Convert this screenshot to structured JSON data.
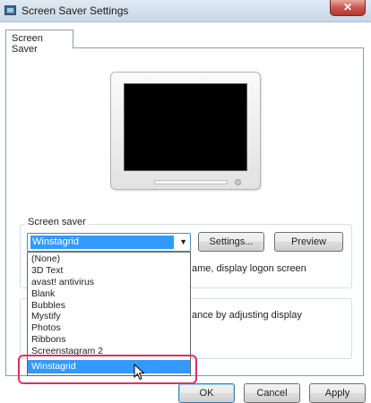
{
  "window": {
    "title": "Screen Saver Settings",
    "close_glyph": "✕"
  },
  "tabs": [
    {
      "label": "Screen Saver"
    }
  ],
  "screen_saver_group": {
    "legend": "Screen saver",
    "selected": "Winstagrid",
    "settings_label": "Settings...",
    "preview_label": "Preview",
    "partial_text": "ame, display logon screen"
  },
  "power_group": {
    "partial_text": "ance by adjusting display"
  },
  "dropdown_options": [
    "(None)",
    "3D Text",
    "avast! antivirus",
    "Blank",
    "Bubbles",
    "Mystify",
    "Photos",
    "Ribbons",
    "Screenstagram 2",
    "Winstagrid"
  ],
  "footer": {
    "ok_label": "OK",
    "cancel_label": "Cancel",
    "apply_label": "Apply"
  },
  "colors": {
    "selection": "#3399ff",
    "highlight_ring": "#d83266"
  },
  "icons": {
    "window_icon": "screen-saver-app-icon",
    "dropdown_arrow": "chevron-down-icon",
    "cursor": "mouse-pointer-icon"
  }
}
